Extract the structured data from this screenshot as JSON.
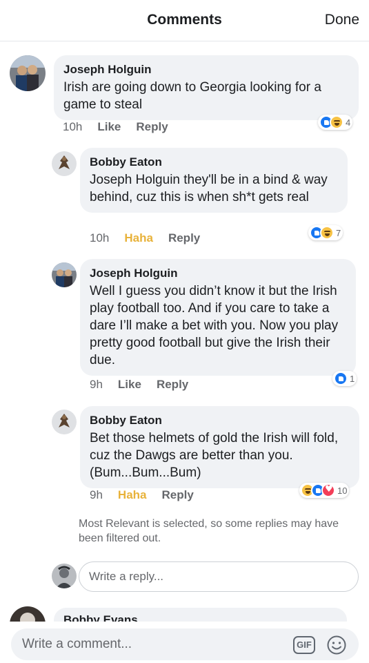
{
  "header": {
    "title": "Comments",
    "done_label": "Done"
  },
  "comments": [
    {
      "author": "Joseph Holguin",
      "text": "Irish are going down to Georgia looking for a game to steal",
      "time": "10h",
      "reaction_label": "Like",
      "reply_label": "Reply",
      "reaction_icons": [
        "like-icon",
        "haha-icon"
      ],
      "reaction_count": "4"
    },
    {
      "author": "Bobby Eaton",
      "text": "Joseph Holguin they'll be in a bind & way behind, cuz this is when sh*t gets real",
      "time": "10h",
      "reaction_label": "Haha",
      "reply_label": "Reply",
      "reaction_icons": [
        "like-icon",
        "haha-icon"
      ],
      "reaction_count": "7"
    },
    {
      "author": "Joseph Holguin",
      "text": "Well I guess you didn’t know it but the Irish play football too. And if you care to take a dare I’ll make a bet with you. Now you play pretty good football but give the Irish their due.",
      "time": "9h",
      "reaction_label": "Like",
      "reply_label": "Reply",
      "reaction_icons": [
        "like-icon"
      ],
      "reaction_count": "1"
    },
    {
      "author": "Bobby Eaton",
      "text": "Bet those helmets of gold the Irish will fold, cuz the Dawgs are better than you. (Bum...Bum...Bum)",
      "time": "9h",
      "reaction_label": "Haha",
      "reply_label": "Reply",
      "reaction_icons": [
        "haha-icon",
        "like-icon",
        "heart-icon"
      ],
      "reaction_count": "10"
    }
  ],
  "filter_notice": "Most Relevant is selected, so some replies may have been filtered out.",
  "reply_placeholder": "Write a reply...",
  "next_comment_author": "Bobby Evans",
  "comment_placeholder": "Write a comment...",
  "gif_label": "GIF",
  "colors": {
    "bubble": "#f0f2f5",
    "like": "#1877f2",
    "haha": "#f7c244",
    "heart": "#f33e58",
    "meta": "#65676b"
  }
}
